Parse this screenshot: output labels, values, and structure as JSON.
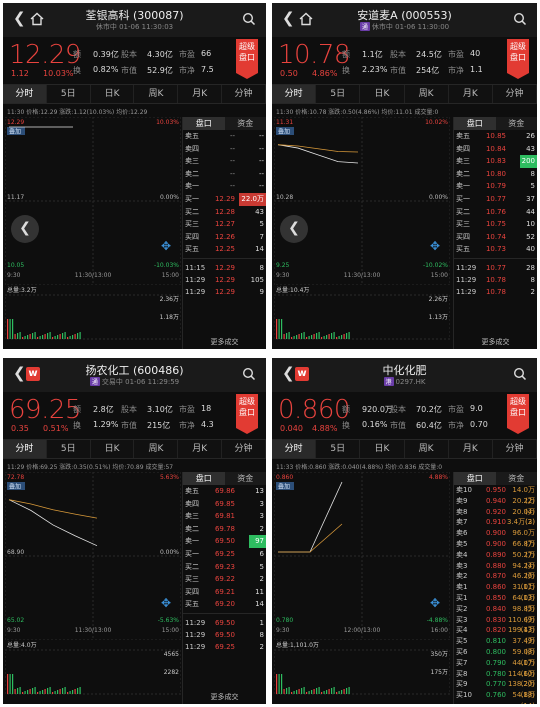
{
  "panels": [
    {
      "title": "荃银高科 (300087)",
      "subtitle": "休市中 01-06 11:30:03",
      "tag": "",
      "price": "12.29",
      "change": "1.12",
      "change_pct": "10.03%",
      "stats": [
        [
          "额",
          "0.39亿"
        ],
        [
          "股本",
          "4.30亿"
        ],
        [
          "市盈",
          "66"
        ],
        [
          "换",
          "0.82%"
        ],
        [
          "市值",
          "52.9亿"
        ],
        [
          "市净",
          "7.5"
        ]
      ],
      "badge": [
        "超级",
        "盘口"
      ],
      "tabs": [
        "分时",
        "5日",
        "日K",
        "周K",
        "月K",
        "分钟"
      ],
      "info": "11:30  价格:12.29  涨跌:1.12(10.03%)  均价:12.29",
      "overlay": "叠加",
      "ylabels": {
        "top": "12.29",
        "mid": "11.17",
        "bot": "10.05",
        "ptop": "10.03%",
        "pmid": "0.00%",
        "pbot": "-10.03%"
      },
      "xlabels": [
        "9:30",
        "11:30/13:00",
        "15:00"
      ],
      "volume": "总量:3.2万",
      "vol_labels": [
        "2.36万",
        "1.18万"
      ],
      "side_tabs": [
        "盘口",
        "资金"
      ],
      "book": [
        [
          "卖五",
          "--",
          "--"
        ],
        [
          "卖四",
          "--",
          "--"
        ],
        [
          "卖三",
          "--",
          "--"
        ],
        [
          "卖二",
          "--",
          "--"
        ],
        [
          "卖一",
          "--",
          "--"
        ],
        [
          "买一",
          "12.29",
          "22.0万"
        ],
        [
          "买二",
          "12.28",
          "43"
        ],
        [
          "买三",
          "12.27",
          "5"
        ],
        [
          "买四",
          "12.26",
          "7"
        ],
        [
          "买五",
          "12.25",
          "14"
        ]
      ],
      "trades": [
        [
          "11:15",
          "12.29",
          "8"
        ],
        [
          "11:29",
          "12.29",
          "105"
        ],
        [
          "11:29",
          "12.29",
          "9"
        ]
      ],
      "more": "更多成交",
      "chart_data": {
        "type": "line",
        "series": [
          {
            "values": [
              12.29,
              12.29,
              12.29,
              12.29,
              12.29
            ]
          }
        ],
        "ylim": [
          10.05,
          12.29
        ]
      }
    },
    {
      "title": "安道麦A (000553)",
      "subtitle": "休市中 01-06 11:30:00",
      "tag": "通",
      "price": "10.78",
      "change": "0.50",
      "change_pct": "4.86%",
      "stats": [
        [
          "额",
          "1.1亿"
        ],
        [
          "股本",
          "24.5亿"
        ],
        [
          "市盈",
          "40"
        ],
        [
          "换",
          "2.23%"
        ],
        [
          "市值",
          "254亿"
        ],
        [
          "市净",
          "1.1"
        ]
      ],
      "badge": [
        "超级",
        "盘口"
      ],
      "tabs": [
        "分时",
        "5日",
        "日K",
        "周K",
        "月K",
        "分钟"
      ],
      "info": "11:30  价格:10.78  涨跌:0.50(4.86%)  均价:11.01  成交量:0",
      "overlay": "叠加",
      "ylabels": {
        "top": "11.31",
        "mid": "10.28",
        "bot": "9.25",
        "ptop": "10.02%",
        "pmid": "0.00%",
        "pbot": "-10.02%"
      },
      "xlabels": [
        "9:30",
        "11:30/13:00",
        "15:00"
      ],
      "volume": "总量:10.4万",
      "vol_labels": [
        "2.26万",
        "1.13万"
      ],
      "side_tabs": [
        "盘口",
        "资金"
      ],
      "book": [
        [
          "卖五",
          "10.85",
          "26"
        ],
        [
          "卖四",
          "10.84",
          "43"
        ],
        [
          "卖三",
          "10.83",
          "200"
        ],
        [
          "卖二",
          "10.80",
          "8"
        ],
        [
          "卖一",
          "10.79",
          "5"
        ],
        [
          "买一",
          "10.77",
          "37"
        ],
        [
          "买二",
          "10.76",
          "44"
        ],
        [
          "买三",
          "10.75",
          "10"
        ],
        [
          "买四",
          "10.74",
          "52"
        ],
        [
          "买五",
          "10.73",
          "40"
        ]
      ],
      "trades": [
        [
          "11:29",
          "10.77",
          "28"
        ],
        [
          "11:29",
          "10.78",
          "8"
        ],
        [
          "11:29",
          "10.78",
          "2"
        ]
      ],
      "more": "更多成交",
      "chart_data": {
        "type": "line",
        "series": [
          {
            "values": [
              11.05,
              11.0,
              10.9,
              10.8,
              10.78
            ]
          }
        ],
        "ylim": [
          9.25,
          11.31
        ]
      }
    },
    {
      "title": "扬农化工 (600486)",
      "subtitle": "交易中 01-06 11:29:59",
      "tag": "通",
      "price": "69.25",
      "change": "0.35",
      "change_pct": "0.51%",
      "stats": [
        [
          "额",
          "2.8亿"
        ],
        [
          "股本",
          "3.10亿"
        ],
        [
          "市盈",
          "18"
        ],
        [
          "换",
          "1.29%"
        ],
        [
          "市值",
          "215亿"
        ],
        [
          "市净",
          "4.3"
        ]
      ],
      "badge": [
        "超级",
        "盘口"
      ],
      "tabs": [
        "分时",
        "5日",
        "日K",
        "周K",
        "月K",
        "分钟"
      ],
      "info": "11:29  价格:69.25  涨跌:0.35(0.51%)  均价:70.89  成交量:57",
      "overlay": "叠加",
      "ylabels": {
        "top": "72.78",
        "mid": "68.90",
        "bot": "65.02",
        "ptop": "5.63%",
        "pmid": "0.00%",
        "pbot": "-5.63%"
      },
      "xlabels": [
        "9:30",
        "11:30/13:00",
        "15:00"
      ],
      "volume": "总量:4.0万",
      "vol_labels": [
        "4565",
        "2282"
      ],
      "side_tabs": [
        "盘口",
        "资金"
      ],
      "book": [
        [
          "卖五",
          "69.86",
          "13"
        ],
        [
          "卖四",
          "69.85",
          "3"
        ],
        [
          "卖三",
          "69.81",
          "3"
        ],
        [
          "卖二",
          "69.78",
          "2"
        ],
        [
          "卖一",
          "69.50",
          "97"
        ],
        [
          "买一",
          "69.25",
          "6"
        ],
        [
          "买二",
          "69.23",
          "5"
        ],
        [
          "买三",
          "69.22",
          "2"
        ],
        [
          "买四",
          "69.21",
          "11"
        ],
        [
          "买五",
          "69.20",
          "14"
        ]
      ],
      "trades": [
        [
          "11:29",
          "69.50",
          "1"
        ],
        [
          "11:29",
          "69.50",
          "8"
        ],
        [
          "11:29",
          "69.25",
          "2"
        ]
      ],
      "more": "更多成交",
      "chart_data": {
        "type": "line",
        "series": [
          {
            "values": [
              71.8,
              71.2,
              70.4,
              69.8,
              69.25
            ]
          }
        ],
        "ylim": [
          65.02,
          72.78
        ]
      }
    },
    {
      "title": "中化化肥",
      "subtitle": "0297.HK",
      "tag": "港",
      "price": "0.860",
      "change": "0.040",
      "change_pct": "4.88%",
      "stats": [
        [
          "额",
          "920.0万"
        ],
        [
          "股本",
          "70.2亿"
        ],
        [
          "市盈",
          "9.0"
        ],
        [
          "换",
          "0.16%"
        ],
        [
          "市值",
          "60.4亿"
        ],
        [
          "市净",
          "0.70"
        ]
      ],
      "badge": [
        "超级",
        "盘口"
      ],
      "tabs": [
        "分时",
        "5日",
        "日K",
        "周K",
        "月K",
        "分钟"
      ],
      "info": "11:33  价格:0.860  涨跌:0.040(4.88%)  均价:0.836  成交量:0",
      "overlay": "叠加",
      "ylabels": {
        "top": "0.860",
        "mid": "",
        "bot": "0.780",
        "ptop": "4.88%",
        "pmid": "",
        "pbot": "-4.88%"
      },
      "xlabels": [
        "9:30",
        "12:00/13:00",
        "16:00"
      ],
      "volume": "总量:1,101.0万",
      "vol_labels": [
        "350万",
        "175万"
      ],
      "side_tabs": [
        "盘口",
        "资金"
      ],
      "book": [
        [
          "卖10",
          "0.950",
          "14.0万(2)"
        ],
        [
          "卖9",
          "0.940",
          "20.2万(4)"
        ],
        [
          "卖8",
          "0.920",
          "20.0万(3)"
        ],
        [
          "卖7",
          "0.910",
          "3.4万(2)"
        ],
        [
          "卖6",
          "0.900",
          "96.0万(7)"
        ],
        [
          "卖5",
          "0.900",
          "66.8万(7)"
        ],
        [
          "卖4",
          "0.890",
          "50.2万(4)"
        ],
        [
          "卖3",
          "0.880",
          "94.2万(6)"
        ],
        [
          "卖2",
          "0.870",
          "46.2万(11)"
        ],
        [
          "卖1",
          "0.860",
          "31.0万(13)"
        ],
        [
          "买1",
          "0.850",
          "64.0万(5)"
        ],
        [
          "买2",
          "0.840",
          "98.8万(9)"
        ],
        [
          "买3",
          "0.830",
          "110.6万(13)"
        ],
        [
          "买4",
          "0.820",
          "199.4万(9)"
        ],
        [
          "买5",
          "0.810",
          "37.4万(8)"
        ],
        [
          "买6",
          "0.800",
          "59.0万(17)"
        ],
        [
          "买7",
          "0.790",
          "44.0万(10)"
        ],
        [
          "买8",
          "0.780",
          "114.6万(20)"
        ],
        [
          "买9",
          "0.770",
          "138.2万(18)"
        ],
        [
          "买10",
          "0.760",
          "54.8万(14)"
        ]
      ],
      "trades": [],
      "more": "",
      "chart_data": {
        "type": "line",
        "series": [
          {
            "values": [
              0.82,
              0.82,
              0.82,
              0.84,
              0.86
            ]
          }
        ],
        "ylim": [
          0.78,
          0.86
        ]
      }
    }
  ],
  "colors": {
    "up": "#e8433e",
    "down": "#2ebd60",
    "bg": "#0e0e0e",
    "avg": "#d99a3a"
  }
}
